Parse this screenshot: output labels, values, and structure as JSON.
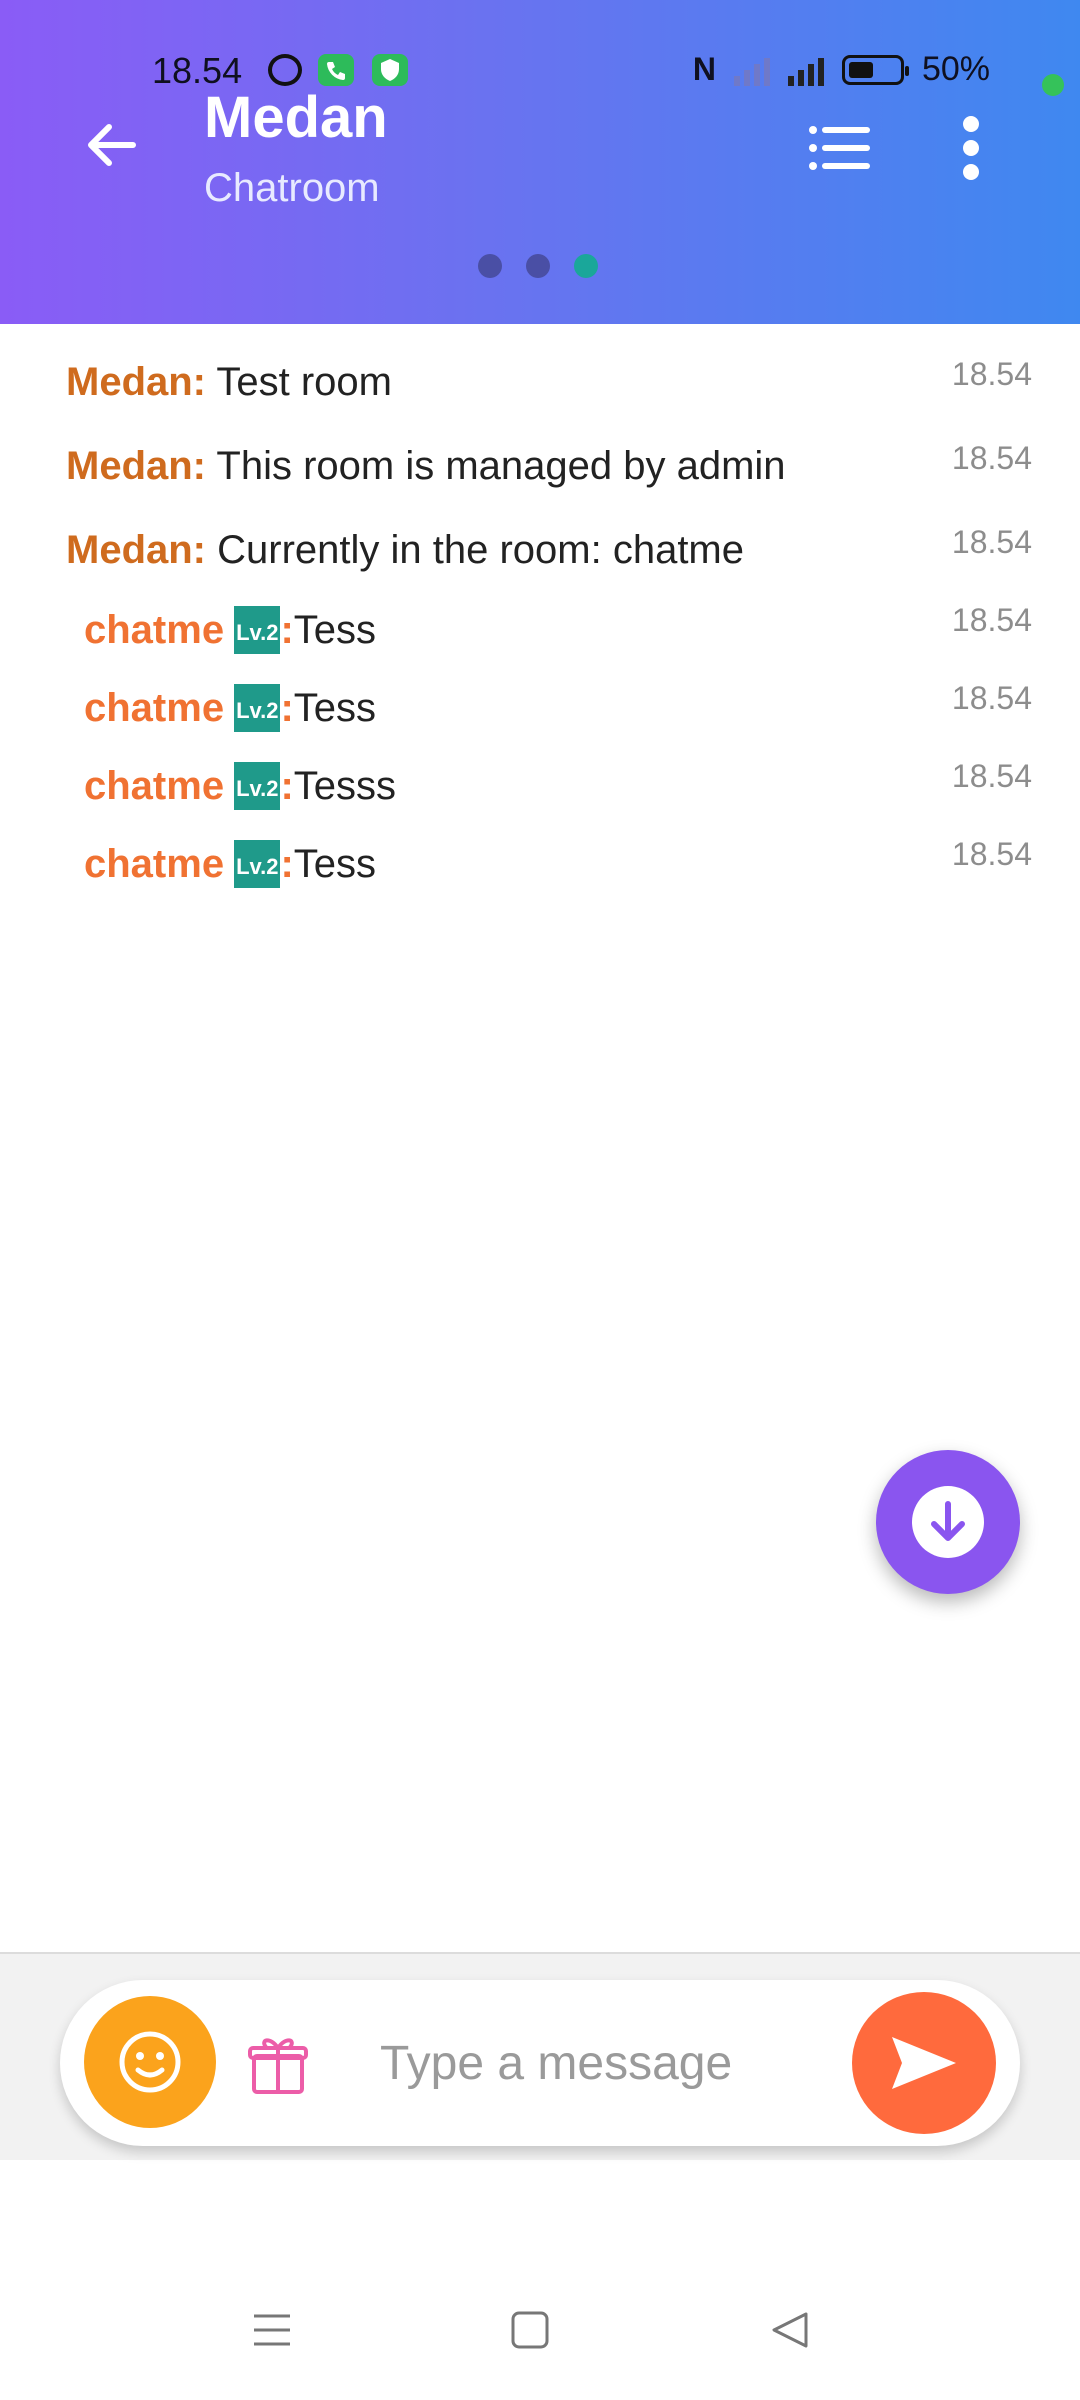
{
  "status_bar": {
    "time": "18.54",
    "network": "4G",
    "battery_percent": "50%",
    "battery_level": 0.5
  },
  "header": {
    "title": "Medan",
    "subtitle": "Chatroom",
    "page_indicator": {
      "count": 3,
      "active_index": 2
    },
    "icons": [
      "back-arrow-icon",
      "list-icon",
      "more-vert-icon"
    ]
  },
  "system_messages": [
    {
      "sender": "Medan:",
      "text": "Test room",
      "time": "18.54"
    },
    {
      "sender": "Medan:",
      "text": "This room is managed by admin",
      "time": "18.54"
    },
    {
      "sender": "Medan:",
      "text": "Currently in the room: chatme",
      "time": "18.54"
    }
  ],
  "user_messages": [
    {
      "user": "chatme",
      "level": "Lv.2",
      "separator": ":",
      "text": "Tess",
      "time": "18.54"
    },
    {
      "user": "chatme",
      "level": "Lv.2",
      "separator": ":",
      "text": "Tess",
      "time": "18.54"
    },
    {
      "user": "chatme",
      "level": "Lv.2",
      "separator": ":",
      "text": "Tesss",
      "time": "18.54"
    },
    {
      "user": "chatme",
      "level": "Lv.2",
      "separator": ":",
      "text": "Tess",
      "time": "18.54"
    }
  ],
  "composer": {
    "placeholder": "Type a message",
    "value": "",
    "icons": [
      "emoji-icon",
      "gift-icon",
      "send-icon"
    ]
  },
  "colors": {
    "header_gradient_start": "#8a5cf6",
    "header_gradient_end": "#3f88f0",
    "system_sender": "#cf6b1e",
    "user_name": "#f07232",
    "level_badge": "#1f9a8a",
    "scroll_fab": "#8a55ef",
    "emoji_button": "#fba31c",
    "send_button": "#ff6a3d"
  }
}
